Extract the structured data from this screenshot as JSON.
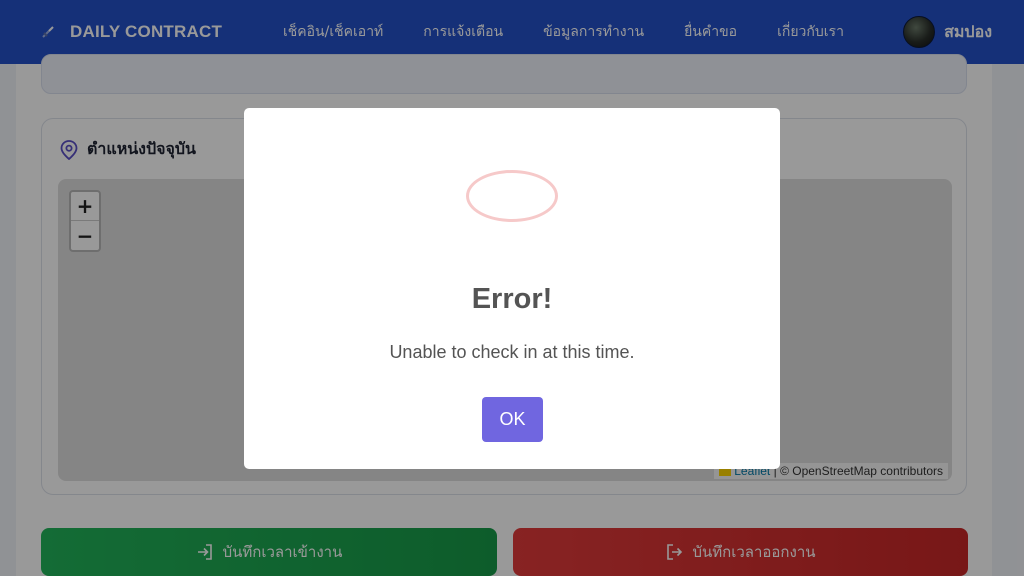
{
  "navbar": {
    "brand": "DAILY CONTRACT",
    "links": [
      "เช็คอิน/เช็คเอาท์",
      "การแจ้งเตือน",
      "ข้อมูลการทำงาน",
      "ยื่นคำขอ",
      "เกี่ยวกับเรา"
    ],
    "user_name": "สมปอง"
  },
  "location": {
    "title": "ตำแหน่งปัจจุบัน",
    "map": {
      "zoom_in": "+",
      "zoom_out": "−",
      "attribution_leaflet": "Leaflet",
      "attribution_separator": "|",
      "attribution_osm": "© OpenStreetMap contributors"
    }
  },
  "actions": {
    "check_in": "บันทึกเวลาเข้างาน",
    "check_out": "บันทึกเวลาออกงาน"
  },
  "modal": {
    "icon": "error-icon",
    "title": "Error!",
    "message": "Unable to check in at this time.",
    "ok_label": "OK"
  },
  "colors": {
    "navbar": "#2451c9",
    "check_in": "#1fae55",
    "check_out": "#d93030",
    "ok_button": "#7066e0",
    "error_ring": "#f6c9c9"
  }
}
